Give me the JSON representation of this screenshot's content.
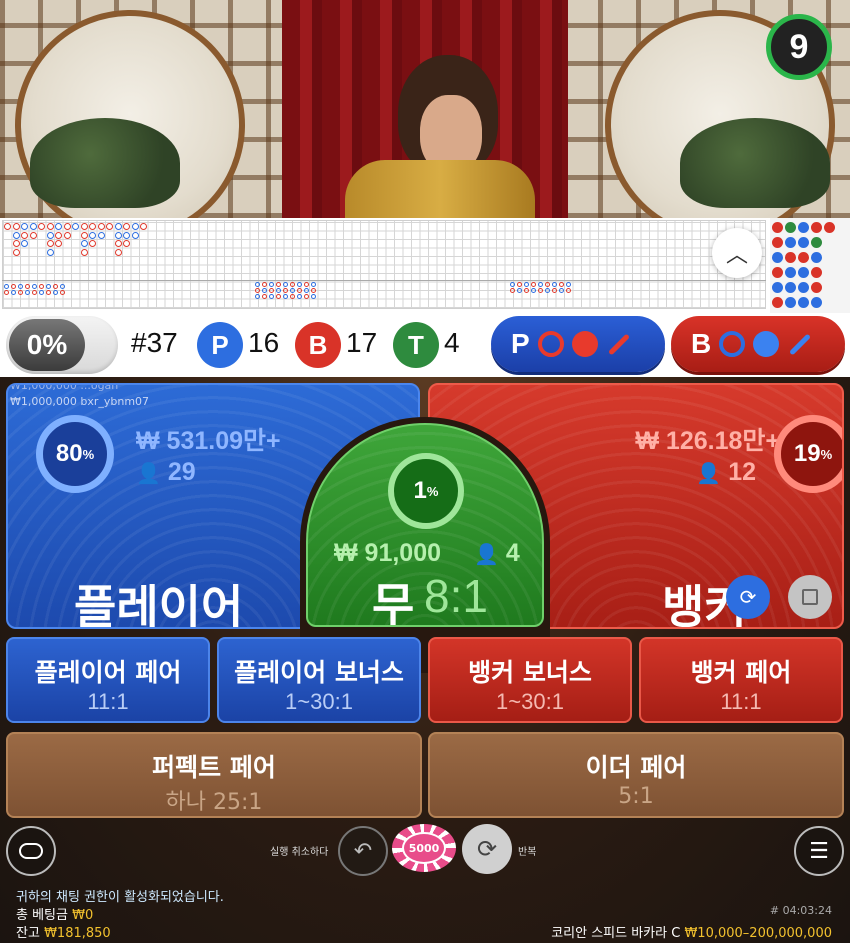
{
  "timer": "9",
  "stats": {
    "percent_toggle": "0%",
    "round": "#37",
    "player_letter": "P",
    "player_count": "16",
    "banker_letter": "B",
    "banker_count": "17",
    "tie_letter": "T",
    "tie_count": "4",
    "predict_player": "P",
    "predict_banker": "B"
  },
  "overlay_users": [
    "₩1,000,000 ...ogan",
    "₩1,000,000 bxr_ybnm07"
  ],
  "player": {
    "percent": "80",
    "pct_sign": "%",
    "amount": "₩ 531.09만+",
    "players": "29",
    "label": "플레이어"
  },
  "tie": {
    "percent": "1",
    "pct_sign": "%",
    "amount": "₩ 91,000",
    "players": "4",
    "label": "무",
    "odds": "8:1"
  },
  "banker": {
    "percent": "19",
    "pct_sign": "%",
    "amount": "₩ 126.18만+",
    "players": "12",
    "label": "뱅커"
  },
  "side_bets": [
    {
      "label": "플레이어 페어",
      "odds": "11:1"
    },
    {
      "label": "플레이어 보너스",
      "odds": "1~30:1"
    },
    {
      "label": "뱅커 보너스",
      "odds": "1~30:1"
    },
    {
      "label": "뱅커 페어",
      "odds": "11:1"
    }
  ],
  "pair_bets": [
    {
      "label": "퍼펙트 페어",
      "odds": "하나 25:1"
    },
    {
      "label": "이더 페어",
      "odds": "5:1"
    }
  ],
  "controls": {
    "undo_label": "실행 취소하다",
    "chip_value": "5000",
    "repeat_label": "반복"
  },
  "footer": {
    "chat_notice": "귀하의 채팅 권한이 활성화되었습니다.",
    "total_bet_label": "총 베팅금",
    "total_bet_value": "₩0",
    "balance_label": "잔고",
    "balance_value": "₩181,850",
    "game_id": "# 04:03:24",
    "table_name": "코리안 스피드 바카라 C",
    "limits": "₩10,000–200,000,000"
  },
  "colors": {
    "player_blue": "#2d6bd6",
    "banker_red": "#d63a2c",
    "tie_green": "#3fa63a",
    "timer_green": "#2bb54a",
    "accent_yellow": "#f2c12e"
  }
}
